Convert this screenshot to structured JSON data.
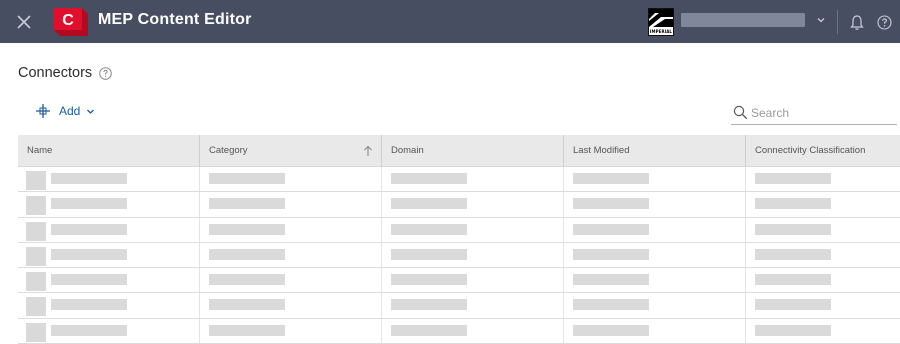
{
  "header": {
    "close_icon": "close-icon",
    "app_logo_letter": "C",
    "app_title": "MEP Content Editor",
    "account_logo_text": "IMPERIAL",
    "account_chevron_icon": "chevron-down-icon",
    "bell_icon": "bell-icon",
    "help_icon": "help-icon"
  },
  "page": {
    "title": "Connectors",
    "help_icon": "help-icon"
  },
  "toolbar": {
    "add_label": "Add",
    "search_placeholder": "Search"
  },
  "table": {
    "columns": [
      {
        "label": "Name"
      },
      {
        "label": "Category",
        "sort": "ascending"
      },
      {
        "label": "Domain"
      },
      {
        "label": "Last Modified"
      },
      {
        "label": "Connectivity Classification"
      }
    ],
    "visible_rows": 7
  },
  "colors": {
    "header_bg": "#474e62",
    "accent_red": "#e0102c",
    "link_blue": "#1b5c9a",
    "table_header_bg": "#e9e9e9",
    "skeleton": "#dadada"
  }
}
